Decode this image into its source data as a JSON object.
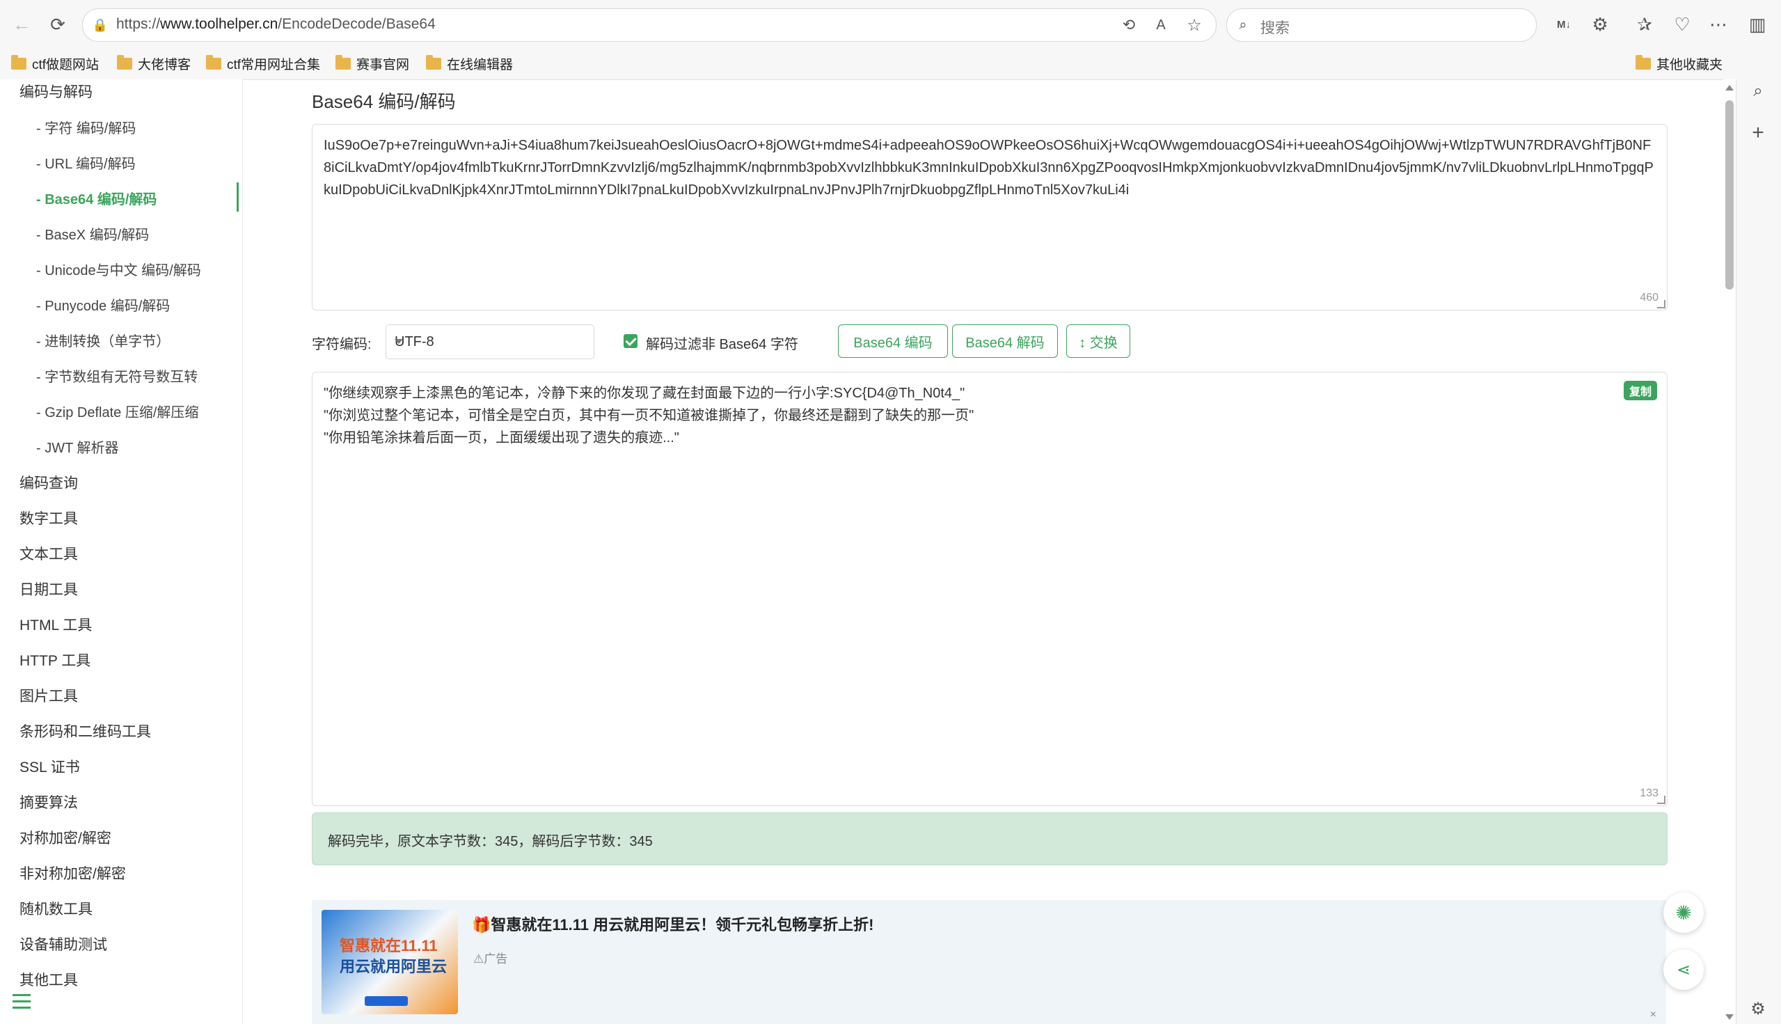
{
  "browser": {
    "url_prefix": "https://",
    "url_host": "www.toolhelper.cn",
    "url_path": "/EncodeDecode/Base64",
    "search_placeholder": "搜索",
    "bookmarks": [
      "ctf做题网站",
      "大佬博客",
      "ctf常用网址合集",
      "赛事官网",
      "在线编辑器"
    ],
    "other_bookmarks": "其他收藏夹"
  },
  "sidebar": {
    "section_encode": "编码与解码",
    "sub_items": [
      "- 字符  编码/解码",
      "- URL  编码/解码",
      "- Base64  编码/解码",
      "- BaseX  编码/解码",
      "- Unicode与中文  编码/解码",
      "- Punycode  编码/解码",
      "- 进制转换（单字节）",
      "- 字节数组有无符号数互转",
      "- Gzip Deflate 压缩/解压缩",
      "- JWT 解析器"
    ],
    "items": [
      "编码查询",
      "数字工具",
      "文本工具",
      "日期工具",
      "HTML 工具",
      "HTTP 工具",
      "图片工具",
      "条形码和二维码工具",
      "SSL 证书",
      "摘要算法",
      "对称加密/解密",
      "非对称加密/解密",
      "随机数工具",
      "设备辅助测试",
      "其他工具"
    ]
  },
  "main": {
    "title": "Base64 编码/解码",
    "input_text": "IuS9oOe7p+e7reinguWvn+aJi+S4iua8hum7keiJsueahOeslOiusOacrO+8jOWGt+mdmeS4i+adpeeahOS9oOWPkeeOsOS6huiXj+WcqOWwgemdouacgOS4i+i+ueeahOS4gOihjOWwj+WtlzpTWUN7RDRAVGhfTjB0NF8iCiLkvaDmtY/op4jov4fmlbTkuKrnrJTorrDmnKzvvIzlj6/mg5zlhajmmK/nqbrnmb3pobXvvIzlhbbkuK3mnInkuIDpobXkuI3nn6XpgZPooqvosIHmkpXmjonkuobvvIzkvaDmnIDnu4jov5jmmK/nv7vliLDkuobnvLrlpLHnmoTpgqPkuIDpobUiCiLkvaDnlKjpk4XnrJTmtoLmirnnnYDlkI7pnaLkuIDpobXvvIzkuIrpnaLnvJPnvJPlh7rnjrDkuobpgZflpLHnmoTnl5Xov7kuLi4i",
    "input_count": "460",
    "charset_label": "字符编码:",
    "charset_value": "UTF-8",
    "filter_label": "解码过滤非 Base64 字符",
    "encode_button": "Base64 编码",
    "decode_button": "Base64 解码",
    "swap_button": "↕ 交换",
    "output_text": "\"你继续观察手上漆黑色的笔记本，冷静下来的你发现了藏在封面最下边的一行小字:SYC{D4@Th_N0t4_\"\n\"你浏览过整个笔记本，可惜全是空白页，其中有一页不知道被谁撕掉了，你最终还是翻到了缺失的那一页\"\n\"你用铅笔涂抹着后面一页，上面缓缓出现了遗失的痕迹...\"",
    "copy_label": "复制",
    "output_count": "133",
    "status_text": "解码完毕，原文本字节数：345，解码后字节数：345"
  },
  "ad": {
    "image_line1": "智惠就在11.11",
    "image_line2": "用云就用阿里云",
    "title": "🎁智惠就在11.11 用云就用阿里云！领千元礼包畅享折上折!",
    "label": "⚠广告",
    "close": "×"
  },
  "colors": {
    "accent": "#3ba55d",
    "status_bg": "#d2e8d9"
  }
}
